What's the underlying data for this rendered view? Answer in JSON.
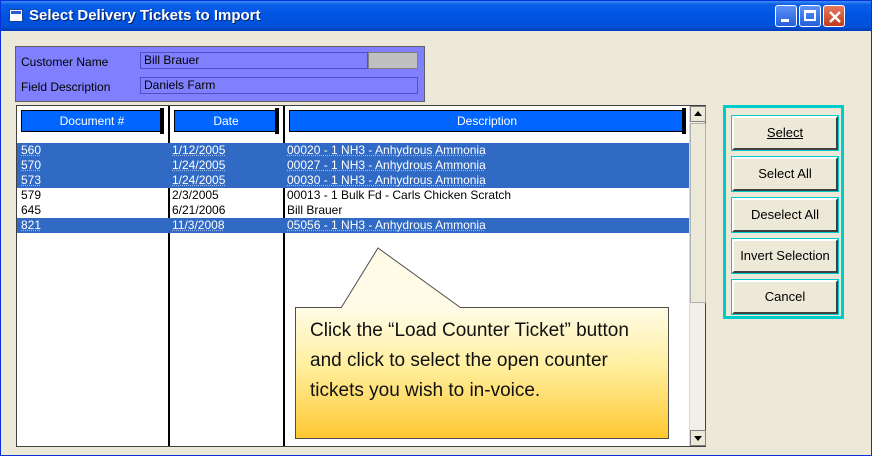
{
  "window": {
    "title": "Select Delivery Tickets to Import"
  },
  "info": {
    "customer_label": "Customer Name",
    "customer_value": "Bill Brauer",
    "field_label": "Field Description",
    "field_value": "Daniels Farm"
  },
  "grid": {
    "columns": [
      "Document #",
      "Date",
      "Description"
    ],
    "rows": [
      {
        "doc": "560",
        "date": "1/12/2005",
        "desc": "00020 - 1 NH3 - Anhydrous Ammonia",
        "selected": true
      },
      {
        "doc": "570",
        "date": "1/24/2005",
        "desc": "00027 - 1 NH3 - Anhydrous Ammonia",
        "selected": true
      },
      {
        "doc": "573",
        "date": "1/24/2005",
        "desc": "00030 - 1 NH3 - Anhydrous Ammonia",
        "selected": true
      },
      {
        "doc": "579",
        "date": "2/3/2005",
        "desc": "00013 - 1 Bulk Fd - Carls Chicken Scratch",
        "selected": false
      },
      {
        "doc": "645",
        "date": "6/21/2006",
        "desc": "Bill Brauer",
        "selected": false
      },
      {
        "doc": "821",
        "date": "11/3/2008",
        "desc": "05056 - 1 NH3 - Anhydrous Ammonia",
        "selected": true
      }
    ]
  },
  "buttons": {
    "select": "Select",
    "select_all": "Select All",
    "deselect_all": "Deselect All",
    "invert_selection": "Invert Selection",
    "cancel": "Cancel"
  },
  "callout": {
    "text": "Click the “Load Counter Ticket” button and click to select the open counter  tickets you wish to in-voice."
  },
  "colors": {
    "title_bar": "#0054e3",
    "selection": "#316ac5",
    "header": "#0066ff",
    "info_panel": "#8080ff",
    "button_border": "#00cccc"
  },
  "icons": [
    "window-icon",
    "minimize-icon",
    "maximize-icon",
    "close-icon",
    "scroll-up-icon",
    "scroll-down-icon"
  ]
}
